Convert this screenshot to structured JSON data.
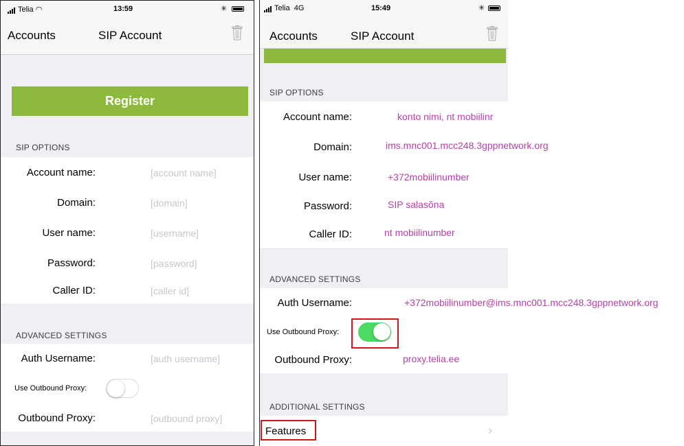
{
  "left": {
    "status": {
      "carrier": "Telia",
      "time": "13:59"
    },
    "nav": {
      "back": "Accounts",
      "title": "SIP Account"
    },
    "register_label": "Register",
    "sip_header": "SIP OPTIONS",
    "sip_rows": [
      {
        "label": "Account name:",
        "placeholder": "[account name]"
      },
      {
        "label": "Domain:",
        "placeholder": "[domain]"
      },
      {
        "label": "User name:",
        "placeholder": "[username]"
      },
      {
        "label": "Password:",
        "placeholder": "[password]"
      },
      {
        "label": "Caller ID:",
        "placeholder": "[caller id]"
      }
    ],
    "adv_header": "ADVANCED SETTINGS",
    "auth_label": "Auth Username:",
    "auth_placeholder": "[auth username]",
    "proxy_toggle_label": "Use Outbound Proxy:",
    "proxy_toggle_on": false,
    "outbound_label": "Outbound Proxy:",
    "outbound_placeholder": "[outbound proxy]"
  },
  "right": {
    "status": {
      "carrier": "Telia",
      "network": "4G",
      "time": "15:49"
    },
    "nav": {
      "back": "Accounts",
      "title": "SIP Account"
    },
    "sip_header": "SIP OPTIONS",
    "sip_rows": [
      {
        "label": "Account name:",
        "value": "konto nimi, nt mobiilinr"
      },
      {
        "label": "Domain:",
        "value": "ims.mnc001.mcc248.3gppnetwork.org"
      },
      {
        "label": "User name:",
        "value": "+372mobiilinumber"
      },
      {
        "label": "Password:",
        "value": "SIP salasõna"
      },
      {
        "label": "Caller ID:",
        "value": "nt mobiilinumber"
      }
    ],
    "adv_header": "ADVANCED SETTINGS",
    "auth_label": "Auth Username:",
    "auth_value": "+372mobiilinumber@ims.mnc001.mcc248.3gppnetwork.org",
    "proxy_toggle_label": "Use Outbound Proxy:",
    "proxy_toggle_on": true,
    "outbound_label": "Outbound Proxy:",
    "outbound_value": "proxy.telia.ee",
    "additional_header": "ADDITIONAL SETTINGS",
    "features_label": "Features"
  },
  "colors": {
    "register_green": "#8dba3d",
    "toggle_on": "#4cd964",
    "annotation_text": "#b43fa8",
    "highlight_red": "#d2161e"
  }
}
